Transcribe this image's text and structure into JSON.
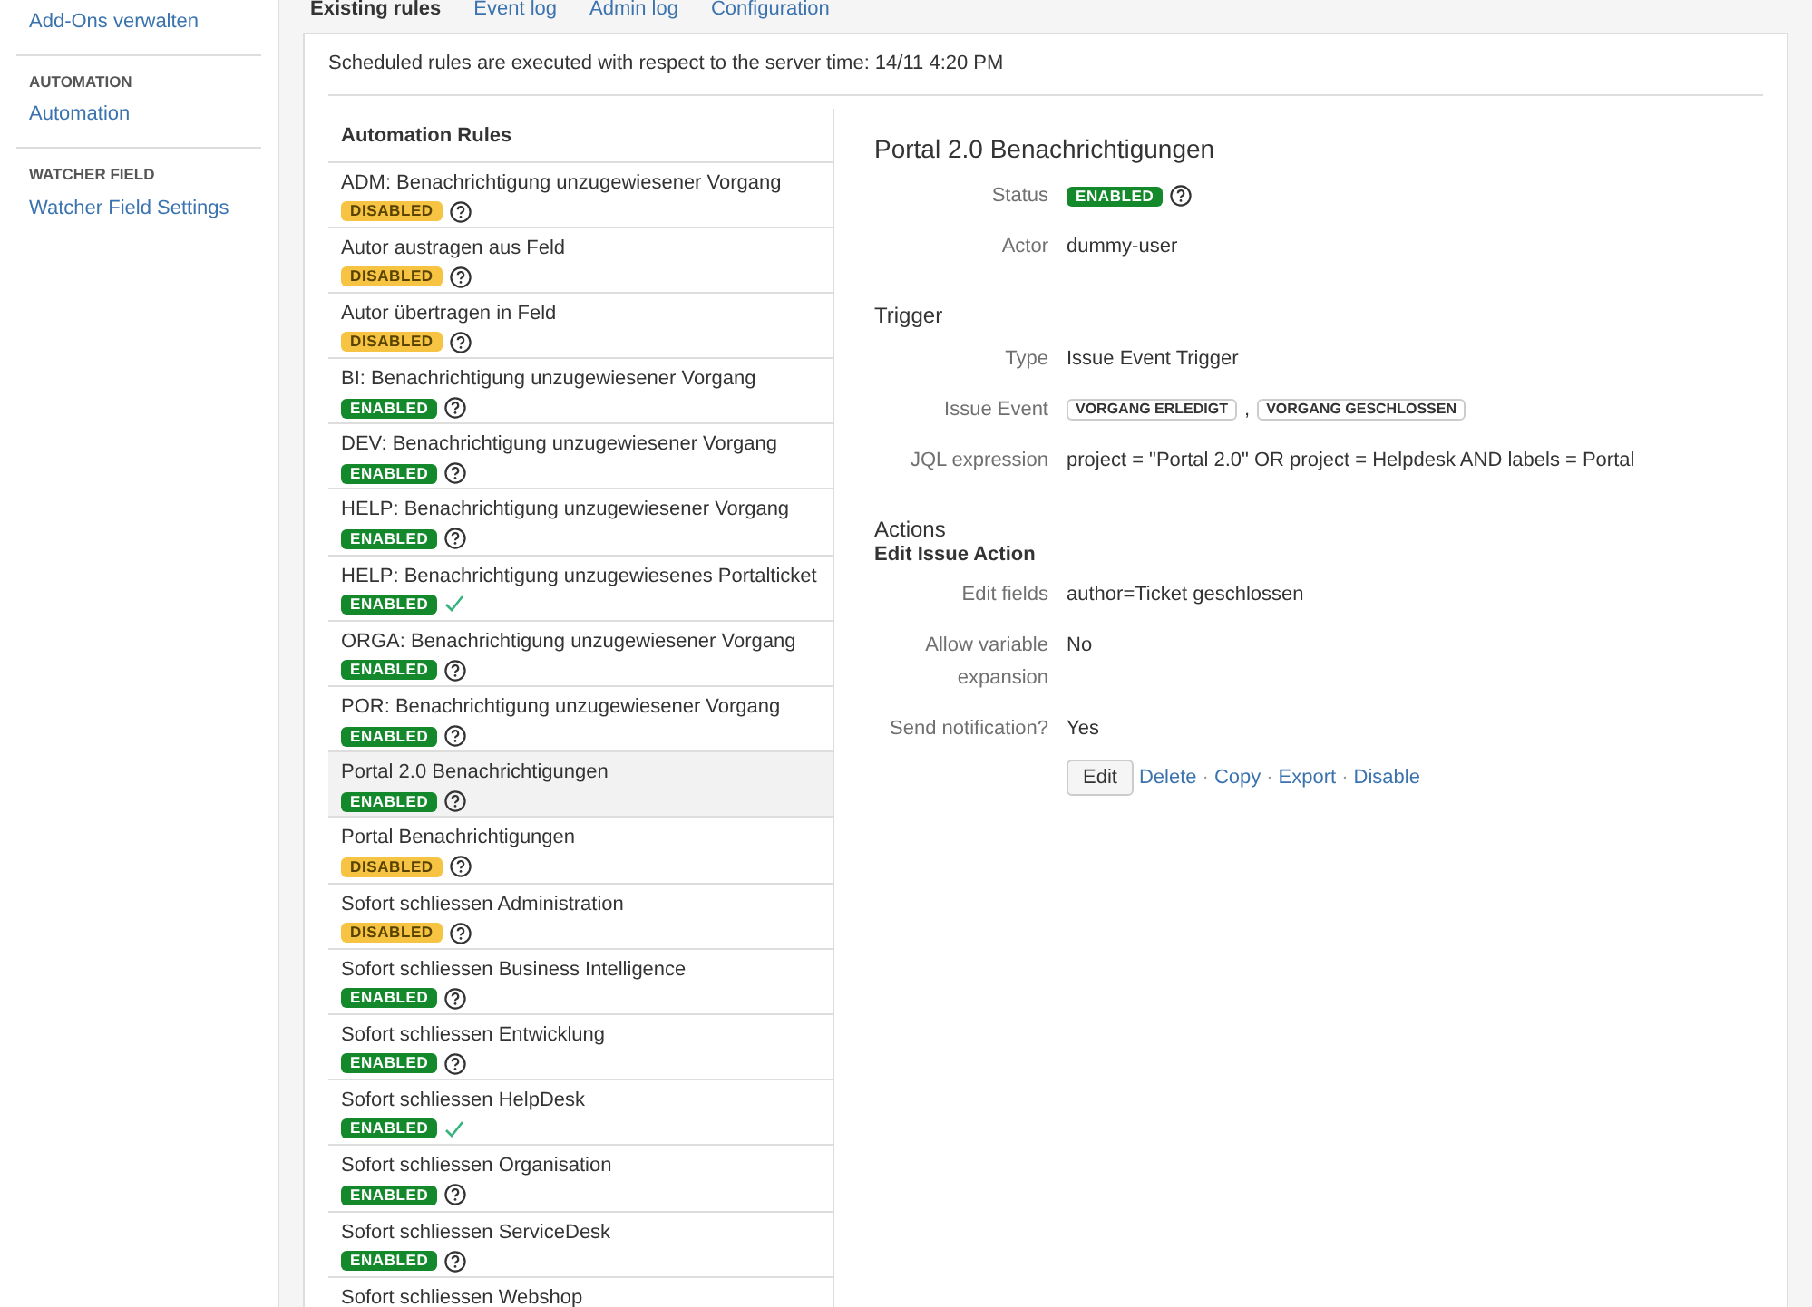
{
  "sidebar": {
    "items": [
      {
        "kind": "link",
        "label": "Add-Ons verwalten"
      },
      {
        "kind": "heading",
        "label": "AUTOMATION"
      },
      {
        "kind": "link",
        "label": "Automation"
      },
      {
        "kind": "heading",
        "label": "WATCHER FIELD"
      },
      {
        "kind": "link",
        "label": "Watcher Field Settings"
      }
    ]
  },
  "tabs": [
    {
      "label": "Existing rules",
      "selected": true
    },
    {
      "label": "Event log",
      "selected": false
    },
    {
      "label": "Admin log",
      "selected": false
    },
    {
      "label": "Configuration",
      "selected": false
    }
  ],
  "notice": "Scheduled rules are executed with respect to the server time: 14/11 4:20 PM",
  "rules": {
    "heading": "Automation Rules",
    "items": [
      {
        "name": "ADM: Benachrichtigung unzugewiesener Vorgang",
        "status": "DISABLED",
        "enabled": false,
        "kind": "help",
        "selected": false
      },
      {
        "name": "Autor austragen aus Feld",
        "status": "DISABLED",
        "enabled": false,
        "kind": "help",
        "selected": false
      },
      {
        "name": "Autor übertragen in Feld",
        "status": "DISABLED",
        "enabled": false,
        "kind": "help",
        "selected": false
      },
      {
        "name": "BI: Benachrichtigung unzugewiesener Vorgang",
        "status": "ENABLED",
        "enabled": true,
        "kind": "help",
        "selected": false
      },
      {
        "name": "DEV: Benachrichtigung unzugewiesener Vorgang",
        "status": "ENABLED",
        "enabled": true,
        "kind": "help",
        "selected": false
      },
      {
        "name": "HELP: Benachrichtigung unzugewiesener Vorgang",
        "status": "ENABLED",
        "enabled": true,
        "kind": "help",
        "selected": false
      },
      {
        "name": "HELP: Benachrichtigung unzugewiesenes Portalticket",
        "status": "ENABLED",
        "enabled": true,
        "kind": "check",
        "selected": false
      },
      {
        "name": "ORGA: Benachrichtigung unzugewiesener Vorgang",
        "status": "ENABLED",
        "enabled": true,
        "kind": "help",
        "selected": false
      },
      {
        "name": "POR: Benachrichtigung unzugewiesener Vorgang",
        "status": "ENABLED",
        "enabled": true,
        "kind": "help",
        "selected": false
      },
      {
        "name": "Portal 2.0 Benachrichtigungen",
        "status": "ENABLED",
        "enabled": true,
        "kind": "help",
        "selected": true
      },
      {
        "name": "Portal Benachrichtigungen",
        "status": "DISABLED",
        "enabled": false,
        "kind": "help",
        "selected": false
      },
      {
        "name": "Sofort schliessen Administration",
        "status": "DISABLED",
        "enabled": false,
        "kind": "help",
        "selected": false
      },
      {
        "name": "Sofort schliessen Business Intelligence",
        "status": "ENABLED",
        "enabled": true,
        "kind": "help",
        "selected": false
      },
      {
        "name": "Sofort schliessen Entwicklung",
        "status": "ENABLED",
        "enabled": true,
        "kind": "help",
        "selected": false
      },
      {
        "name": "Sofort schliessen HelpDesk",
        "status": "ENABLED",
        "enabled": true,
        "kind": "check",
        "selected": false
      },
      {
        "name": "Sofort schliessen Organisation",
        "status": "ENABLED",
        "enabled": true,
        "kind": "help",
        "selected": false
      },
      {
        "name": "Sofort schliessen ServiceDesk",
        "status": "ENABLED",
        "enabled": true,
        "kind": "help",
        "selected": false
      },
      {
        "name": "Sofort schliessen Webshop"
      }
    ]
  },
  "detail": {
    "title": "Portal 2.0 Benachrichtigungen",
    "status": {
      "label": "Status",
      "value": "ENABLED",
      "enabled": true
    },
    "actor": {
      "label": "Actor",
      "value": "dummy-user"
    },
    "trigger": {
      "heading": "Trigger",
      "fields": [
        {
          "label": "Type",
          "value": "Issue Event Trigger"
        },
        {
          "label": "Issue Event",
          "events": [
            "VORGANG ERLEDIGT",
            "VORGANG GESCHLOSSEN"
          ],
          "separator": ","
        },
        {
          "label": "JQL expression",
          "value": "project = \"Portal 2.0\" OR project = Helpdesk AND labels = Portal"
        }
      ]
    },
    "actions": {
      "heading": "Actions",
      "subheading": "Edit Issue Action",
      "fields": [
        {
          "label": "Edit fields",
          "value": "author=Ticket geschlossen"
        },
        {
          "label": "Allow variable expansion",
          "value": "No"
        },
        {
          "label": "Send notification?",
          "value": "Yes"
        }
      ]
    },
    "button": "Edit",
    "links": [
      "Delete",
      "Copy",
      "Export",
      "Disable"
    ],
    "link_separator": "·"
  }
}
